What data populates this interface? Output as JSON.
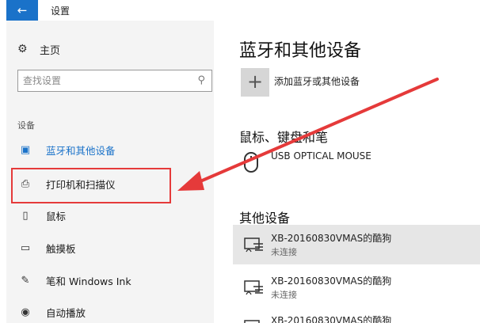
{
  "window": {
    "title": "设置",
    "back_glyph": "←"
  },
  "sidebar": {
    "home_label": "主页",
    "home_glyph": "⚙",
    "search": {
      "placeholder": "查找设置",
      "icon_glyph": "⚲"
    },
    "section_header": "设备",
    "items": [
      {
        "label": "蓝牙和其他设备",
        "glyph": "▣",
        "icon": "bluetooth-devices-icon",
        "active": true
      },
      {
        "label": "打印机和扫描仪",
        "glyph": "⎙",
        "icon": "printer-icon",
        "active": false
      },
      {
        "label": "鼠标",
        "glyph": "▯",
        "icon": "mouse-icon",
        "active": false
      },
      {
        "label": "触摸板",
        "glyph": "▭",
        "icon": "touchpad-icon",
        "active": false
      },
      {
        "label": "笔和 Windows Ink",
        "glyph": "✎",
        "icon": "pen-icon",
        "active": false
      },
      {
        "label": "自动播放",
        "glyph": "◉",
        "icon": "autoplay-icon",
        "active": false
      }
    ]
  },
  "main": {
    "title": "蓝牙和其他设备",
    "add_device": {
      "label": "添加蓝牙或其他设备",
      "glyph": "+"
    },
    "mouse_section": {
      "title": "鼠标、键盘和笔",
      "device_name": "USB OPTICAL MOUSE"
    },
    "other_section": {
      "title": "其他设备",
      "devices": [
        {
          "name": "XB-20160830VMAS的酷狗",
          "status": "未连接"
        },
        {
          "name": "XB-20160830VMAS的酷狗",
          "status": "未连接"
        },
        {
          "name": "XB-20160830VMAS的酷狗",
          "status": ""
        }
      ]
    }
  },
  "colors": {
    "accent": "#1a72c9",
    "annotation": "#e53a3a",
    "sidebar_bg": "#f4f4f4"
  }
}
